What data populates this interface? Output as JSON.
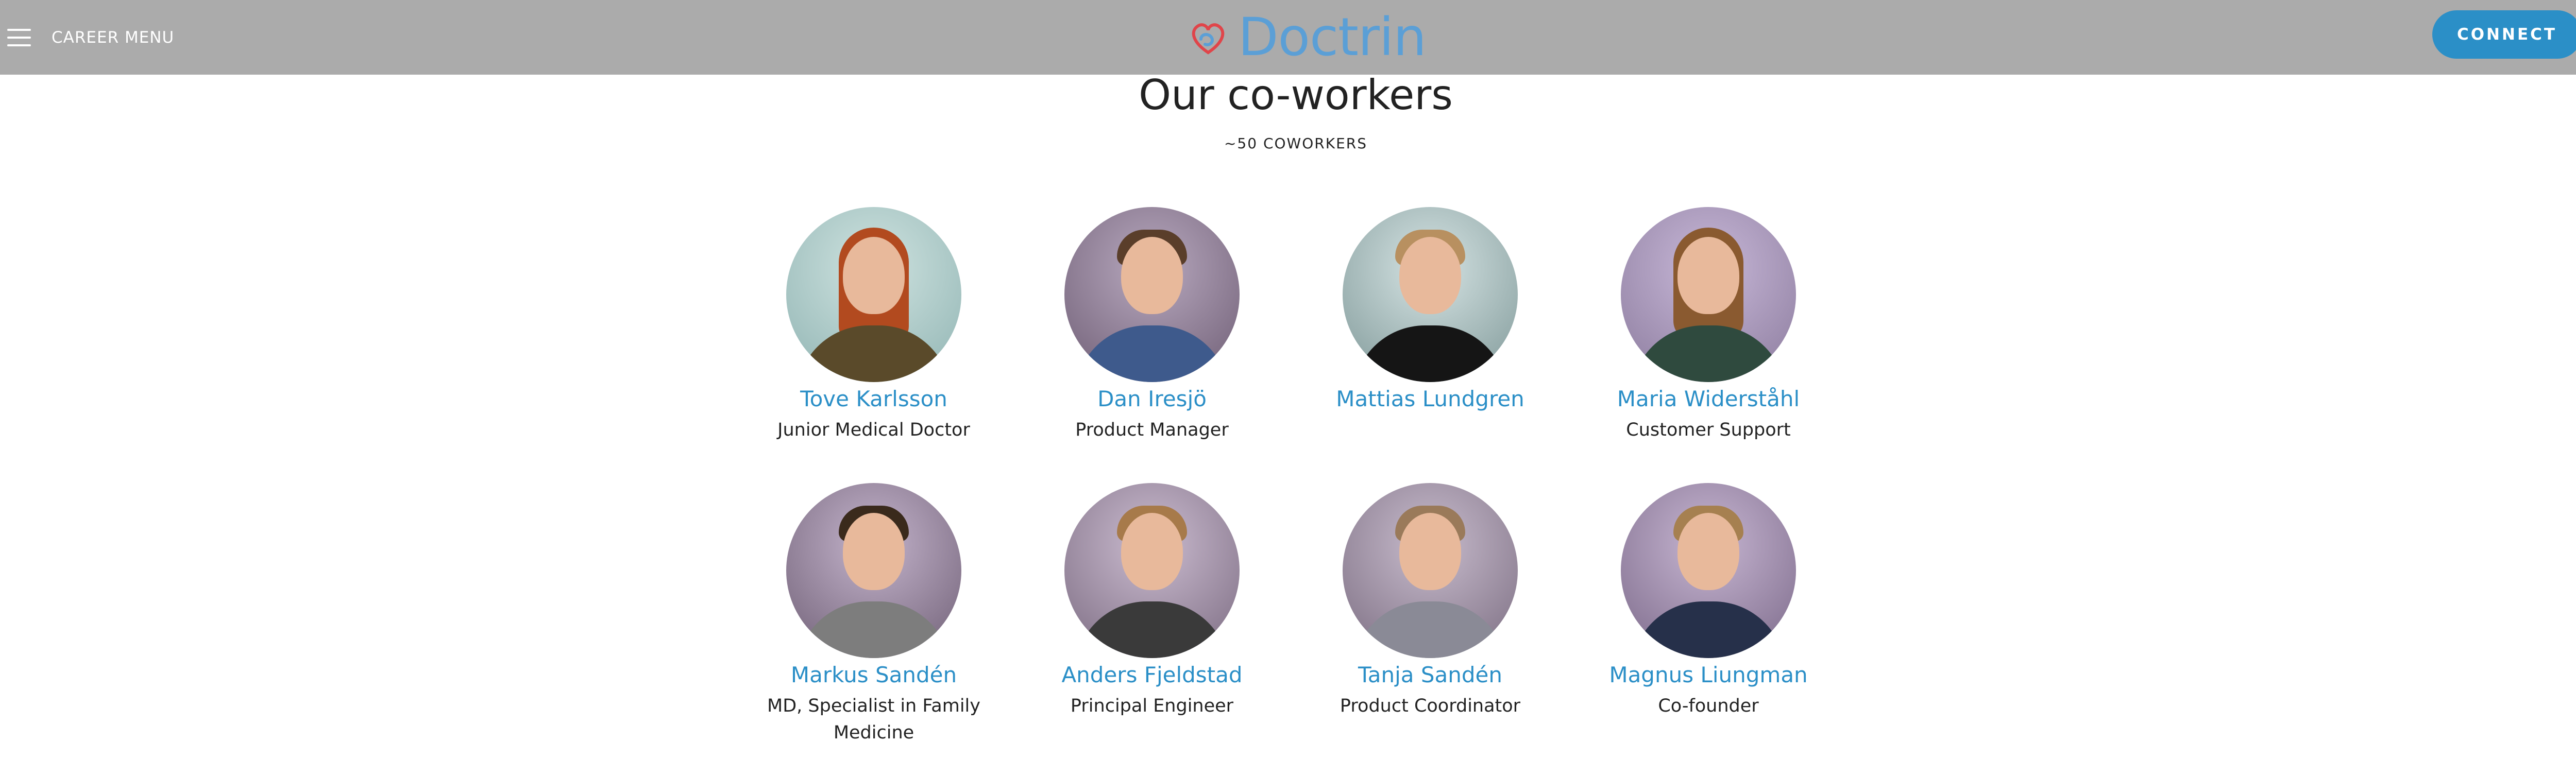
{
  "header": {
    "menu_label": "CAREER MENU",
    "logo_text": "Doctrin",
    "connect_label": "CONNECT",
    "colors": {
      "bar": "#ababab",
      "accent": "#2b8fc7",
      "logo": "#5b9fd6",
      "logo_mark": "#e0454a"
    }
  },
  "section": {
    "title": "Our co-workers",
    "subtitle": "~50 COWORKERS"
  },
  "people": [
    {
      "name": "Tove Karlsson",
      "role": "Junior Medical Doctor"
    },
    {
      "name": "Dan Iresjö",
      "role": "Product Manager"
    },
    {
      "name": "Mattias Lundgren",
      "role": ""
    },
    {
      "name": "Maria Widerståhl",
      "role": "Customer Support"
    },
    {
      "name": "Markus Sandén",
      "role": "MD, Specialist in Family Medicine"
    },
    {
      "name": "Anders Fjeldstad",
      "role": "Principal Engineer"
    },
    {
      "name": "Tanja Sandén",
      "role": "Product Coordinator"
    },
    {
      "name": "Magnus Liungman",
      "role": "Co-founder"
    }
  ]
}
